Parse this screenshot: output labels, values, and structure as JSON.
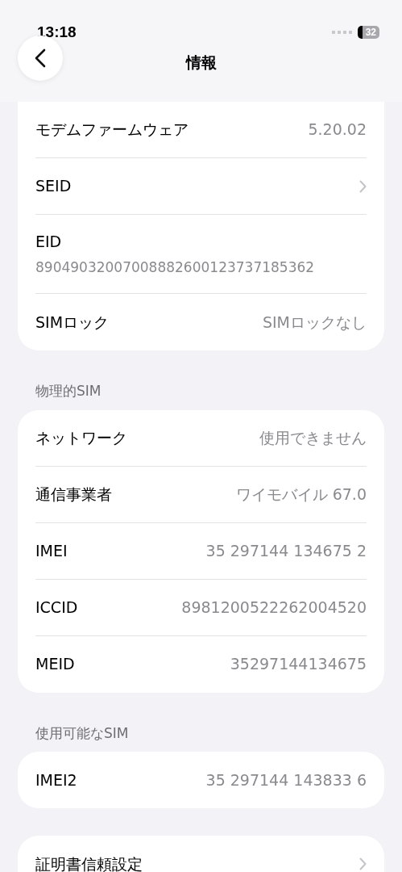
{
  "status_bar": {
    "time": "13:18",
    "battery": "32"
  },
  "nav": {
    "title": "情報"
  },
  "sections": [
    {
      "rows": [
        {
          "kind": "value",
          "label": "モデムファームウェア",
          "value": "5.20.02"
        },
        {
          "kind": "link",
          "label": "SEID"
        },
        {
          "kind": "stacked",
          "label": "EID",
          "value": "89049032007008882600123737185362"
        },
        {
          "kind": "value",
          "label": "SIMロック",
          "value": "SIMロックなし"
        }
      ]
    },
    {
      "header": "物理的SIM",
      "rows": [
        {
          "kind": "value",
          "label": "ネットワーク",
          "value": "使用できません"
        },
        {
          "kind": "value",
          "label": "通信事業者",
          "value": "ワイモバイル 67.0"
        },
        {
          "kind": "value",
          "label": "IMEI",
          "value": "35 297144 134675 2"
        },
        {
          "kind": "value",
          "label": "ICCID",
          "value": "8981200522262004520"
        },
        {
          "kind": "value",
          "label": "MEID",
          "value": "35297144134675"
        }
      ]
    },
    {
      "header": "使用可能なSIM",
      "rows": [
        {
          "kind": "value",
          "label": "IMEI2",
          "value": "35 297144 143833 6"
        }
      ]
    },
    {
      "rows": [
        {
          "kind": "link",
          "label": "証明書信頼設定"
        }
      ]
    }
  ]
}
